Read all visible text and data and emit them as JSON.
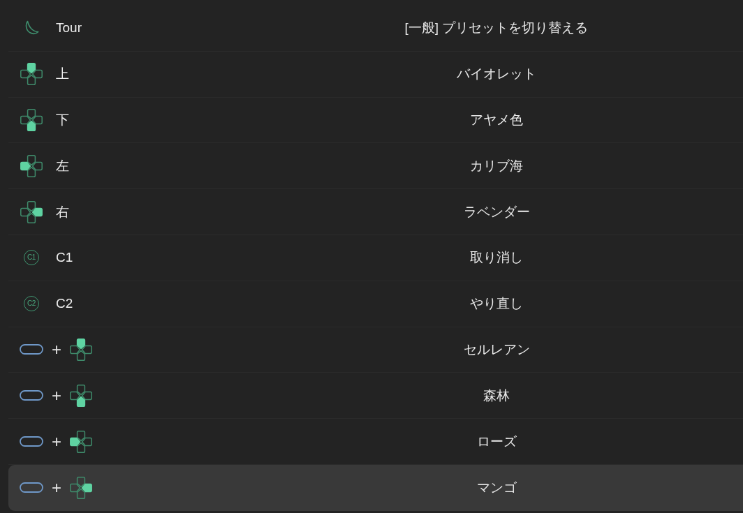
{
  "bindings": [
    {
      "input": [
        {
          "kind": "moon"
        },
        {
          "kind": "label",
          "text": "Tour"
        }
      ],
      "action": "[一般] プリセットを切り替える",
      "selected": false
    },
    {
      "input": [
        {
          "kind": "dpad-up"
        },
        {
          "kind": "label",
          "text": "上"
        }
      ],
      "action": "バイオレット",
      "selected": false
    },
    {
      "input": [
        {
          "kind": "dpad-down"
        },
        {
          "kind": "label",
          "text": "下"
        }
      ],
      "action": "アヤメ色",
      "selected": false
    },
    {
      "input": [
        {
          "kind": "dpad-left"
        },
        {
          "kind": "label",
          "text": "左"
        }
      ],
      "action": "カリブ海",
      "selected": false
    },
    {
      "input": [
        {
          "kind": "dpad-right"
        },
        {
          "kind": "label",
          "text": "右"
        }
      ],
      "action": "ラベンダー",
      "selected": false
    },
    {
      "input": [
        {
          "kind": "circled",
          "text": "C1"
        },
        {
          "kind": "label",
          "text": "C1"
        }
      ],
      "action": "取り消し",
      "selected": false
    },
    {
      "input": [
        {
          "kind": "circled",
          "text": "C2"
        },
        {
          "kind": "label",
          "text": "C2"
        }
      ],
      "action": "やり直し",
      "selected": false
    },
    {
      "input": [
        {
          "kind": "capsule"
        },
        {
          "kind": "joiner",
          "text": "+"
        },
        {
          "kind": "dpad-up"
        }
      ],
      "action": "セルレアン",
      "selected": false
    },
    {
      "input": [
        {
          "kind": "capsule"
        },
        {
          "kind": "joiner",
          "text": "+"
        },
        {
          "kind": "dpad-down"
        }
      ],
      "action": "森林",
      "selected": false
    },
    {
      "input": [
        {
          "kind": "capsule"
        },
        {
          "kind": "joiner",
          "text": "+"
        },
        {
          "kind": "dpad-left"
        }
      ],
      "action": "ローズ",
      "selected": false
    },
    {
      "input": [
        {
          "kind": "capsule"
        },
        {
          "kind": "joiner",
          "text": "+"
        },
        {
          "kind": "dpad-right"
        }
      ],
      "action": "マンゴ",
      "selected": true
    }
  ]
}
